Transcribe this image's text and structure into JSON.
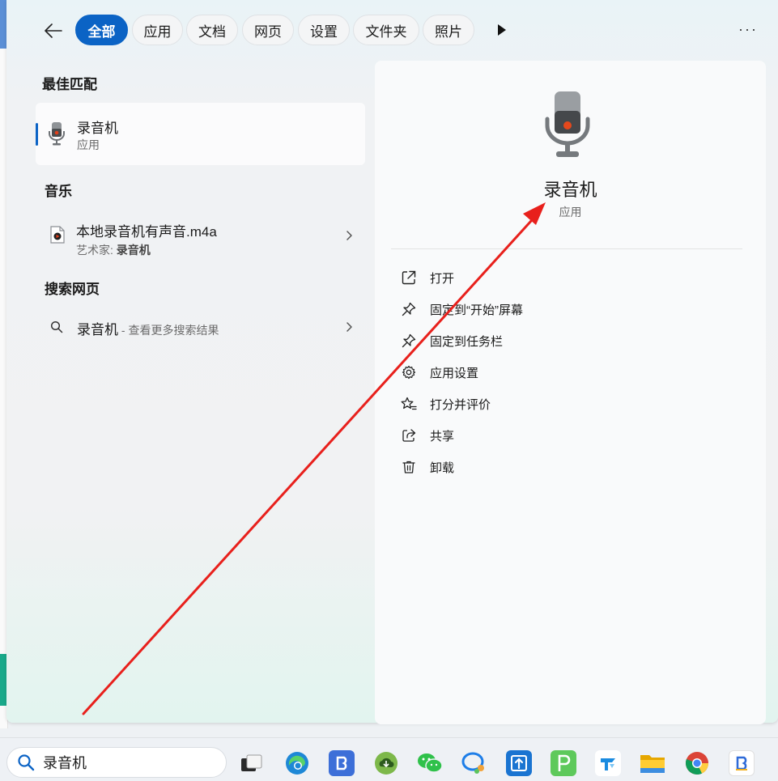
{
  "tabs": [
    {
      "label": "全部",
      "active": true
    },
    {
      "label": "应用",
      "active": false
    },
    {
      "label": "文档",
      "active": false
    },
    {
      "label": "网页",
      "active": false
    },
    {
      "label": "设置",
      "active": false
    },
    {
      "label": "文件夹",
      "active": false
    },
    {
      "label": "照片",
      "active": false
    }
  ],
  "more_label": "···",
  "best_match": {
    "section": "最佳匹配",
    "title": "录音机",
    "subtitle": "应用"
  },
  "music": {
    "section": "音乐",
    "title": "本地录音机有声音.m4a",
    "artist_label": "艺术家: ",
    "artist": "录音机"
  },
  "web": {
    "section": "搜索网页",
    "query": "录音机",
    "hint": " - 查看更多搜索结果"
  },
  "detail": {
    "name": "录音机",
    "type": "应用",
    "actions": [
      {
        "label": "打开",
        "icon": "open-external-icon"
      },
      {
        "label": "固定到“开始”屏幕",
        "icon": "pin-icon"
      },
      {
        "label": "固定到任务栏",
        "icon": "pin-icon"
      },
      {
        "label": "应用设置",
        "icon": "gear-icon"
      },
      {
        "label": "打分并评价",
        "icon": "star-icon"
      },
      {
        "label": "共享",
        "icon": "share-icon"
      },
      {
        "label": "卸载",
        "icon": "trash-icon"
      }
    ]
  },
  "taskbar": {
    "search_text": "录音机",
    "apps": [
      "task-view",
      "edge",
      "app-blue-b",
      "app-green-cloud",
      "wechat",
      "chat-bubble",
      "app-upload",
      "app-green-p",
      "app-blue-arrow",
      "file-explorer",
      "chrome",
      "app-b-white"
    ]
  },
  "colors": {
    "accent": "#0b63c5",
    "arrow": "#e8201c"
  }
}
